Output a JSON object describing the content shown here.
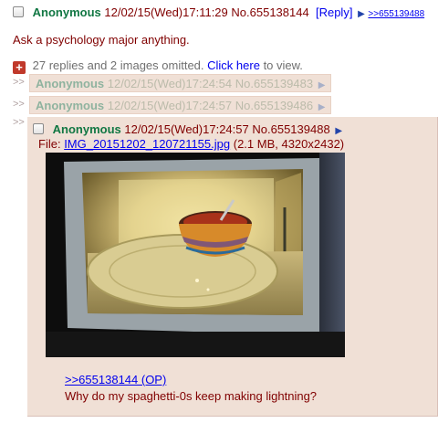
{
  "op": {
    "name": "Anonymous",
    "datetime": "12/02/15(Wed)17:11:29",
    "post_no": "No.655138144",
    "reply_label": "Reply",
    "backlink": ">>655139488",
    "comment": "Ask a psychology major anything."
  },
  "omitted": {
    "text": "27 replies and 2 images omitted.",
    "link": "Click here",
    "suffix": "to view."
  },
  "side_arrows": ">>",
  "hidden_replies": [
    {
      "name": "Anonymous",
      "datetime": "12/02/15(Wed)17:24:54",
      "post_no": "No.655139483"
    },
    {
      "name": "Anonymous",
      "datetime": "12/02/15(Wed)17:24:57",
      "post_no": "No.655139486"
    }
  ],
  "reply": {
    "name": "Anonymous",
    "datetime": "12/02/15(Wed)17:24:57",
    "post_no": "No.655139488",
    "file_label": "File:",
    "file_name": "IMG_20151202_120721155.jpg",
    "file_info": "(2.1 MB, 4320x2432)",
    "quote": ">>655138144 (OP)",
    "comment": "Why do my spaghetti-0s keep making lightning?"
  },
  "icons": {
    "arrow": "▶",
    "expand": "+",
    "checkbox": "checkbox-icon"
  },
  "colors": {
    "name": "#117743",
    "text": "#800000",
    "link": "#0000ee",
    "reply_bg": "#f0e0d6",
    "expand_button": "#c0392b"
  }
}
